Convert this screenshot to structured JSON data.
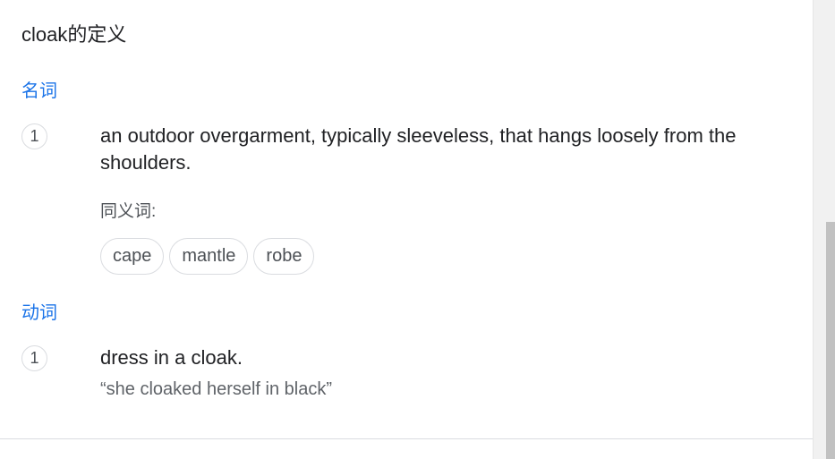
{
  "title": "cloak的定义",
  "entries": [
    {
      "part_of_speech": "名词",
      "senses": [
        {
          "number": "1",
          "definition": "an outdoor overgarment, typically sleeveless, that hangs loosely from the shoulders.",
          "synonyms_label": "同义词:",
          "synonyms": [
            "cape",
            "mantle",
            "robe"
          ]
        }
      ]
    },
    {
      "part_of_speech": "动词",
      "senses": [
        {
          "number": "1",
          "definition": "dress in a cloak.",
          "example": "“she cloaked herself in black”"
        }
      ]
    }
  ],
  "colors": {
    "part_of_speech": "#1a73e8",
    "text": "#202124",
    "secondary_text": "#4d5156",
    "border": "#dadce0"
  }
}
